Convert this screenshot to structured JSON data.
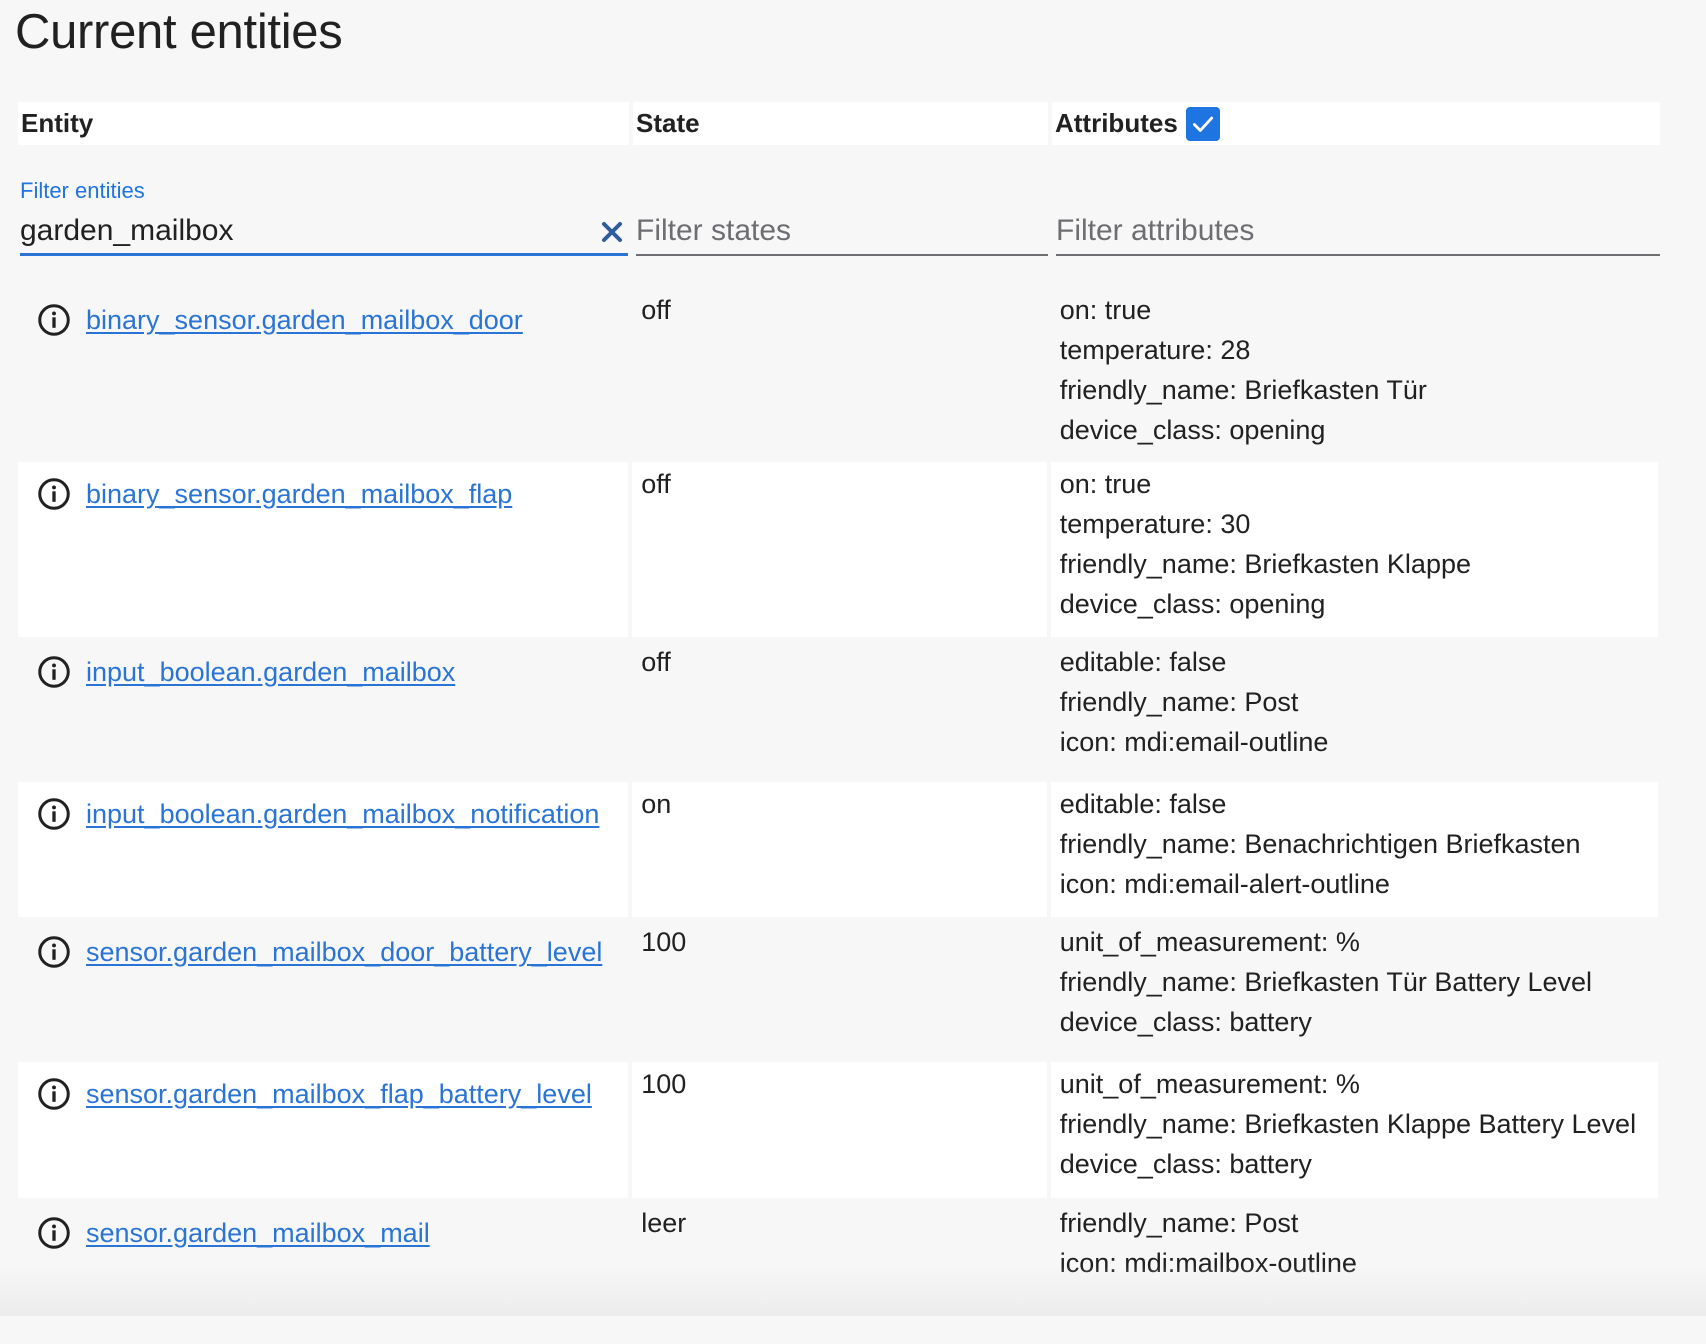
{
  "page": {
    "title": "Current entities"
  },
  "table": {
    "headers": {
      "entity": "Entity",
      "state": "State",
      "attributes": "Attributes"
    },
    "attributes_checkbox": {
      "checked": true,
      "icon": "check-icon",
      "color": "#1e74e0"
    },
    "filters": {
      "entity_label": "Filter entities",
      "entity_value": "garden_mailbox",
      "clear_icon": "close-icon",
      "state_placeholder": "Filter states",
      "attributes_placeholder": "Filter attributes"
    },
    "rows": [
      {
        "entity": "binary_sensor.garden_mailbox_door",
        "state": "off",
        "attributes": [
          "on: true",
          "temperature: 28",
          "friendly_name: Briefkasten Tür",
          "device_class: opening"
        ]
      },
      {
        "entity": "binary_sensor.garden_mailbox_flap",
        "state": "off",
        "attributes": [
          "on: true",
          "temperature: 30",
          "friendly_name: Briefkasten Klappe",
          "device_class: opening"
        ]
      },
      {
        "entity": "input_boolean.garden_mailbox",
        "state": "off",
        "attributes": [
          "editable: false",
          "friendly_name: Post",
          "icon: mdi:email-outline"
        ]
      },
      {
        "entity": "input_boolean.garden_mailbox_notification",
        "state": "on",
        "attributes": [
          "editable: false",
          "friendly_name: Benachrichtigen Briefkasten",
          "icon: mdi:email-alert-outline"
        ]
      },
      {
        "entity": "sensor.garden_mailbox_door_battery_level",
        "state": "100",
        "attributes": [
          "unit_of_measurement: %",
          "friendly_name: Briefkasten Tür Battery Level",
          "device_class: battery"
        ]
      },
      {
        "entity": "sensor.garden_mailbox_flap_battery_level",
        "state": "100",
        "attributes": [
          "unit_of_measurement: %",
          "friendly_name: Briefkasten Klappe Battery Level",
          "device_class: battery"
        ]
      },
      {
        "entity": "sensor.garden_mailbox_mail",
        "state": "leer",
        "attributes": [
          "friendly_name: Post",
          "icon: mdi:mailbox-outline"
        ]
      }
    ]
  },
  "colors": {
    "accent": "#2a74d6",
    "text": "#212121",
    "background": "#f7f7f7"
  }
}
